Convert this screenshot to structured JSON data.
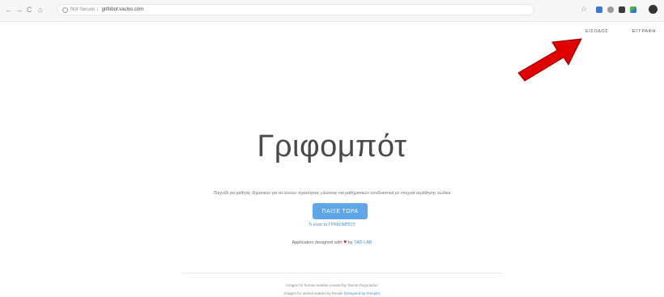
{
  "browser": {
    "nav_back": "←",
    "nav_forward": "→",
    "nav_reload": "C",
    "nav_home": "⌂",
    "security_label": "Not Secure",
    "url": "grifobot.vaclos.com"
  },
  "header": {
    "login": "ΕΙΣΟΔΟΣ",
    "register": "ΕΓΓΡΑΦΗ"
  },
  "hero": {
    "title": "Γριφομπότ",
    "subtitle": "Παιχνίδι για μαθητές δημοτικού για να λύνουν προκλήσεις γλώσσας και μαθηματικών συνδυαστικά με στοιχεία εκμάθησης κώδικα",
    "play_button": "ΠΑΙΞΕ ΤΩΡΑ",
    "tutorial_link": "Τι είναι το ΓΡΙΦΟΜΠΟΤ"
  },
  "credit": {
    "prefix": "Application designed with",
    "heart": "♥",
    "by": "by",
    "lab": "TAD LAB"
  },
  "footer": {
    "line1": "Images for human avatars created by Tannis Grigoriadou",
    "line2_prefix": "Images for animal avatars by freepik",
    "line2_link": "(Designed by Freepik)"
  },
  "colors": {
    "accent": "#5fa6e8",
    "arrow": "#e00000",
    "heart": "#e02424"
  }
}
